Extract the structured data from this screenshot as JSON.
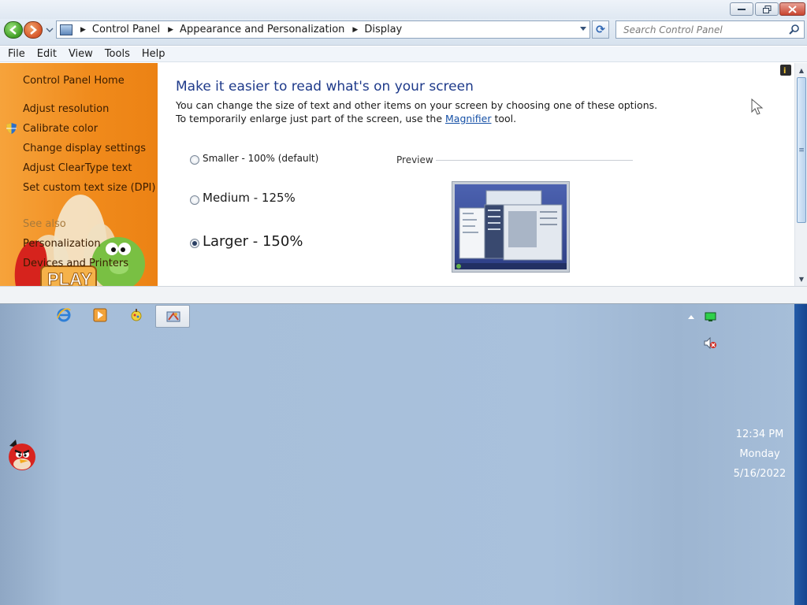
{
  "window": {
    "breadcrumbs": [
      "Control Panel",
      "Appearance and Personalization",
      "Display"
    ],
    "search_placeholder": "Search Control Panel",
    "menu": [
      "File",
      "Edit",
      "View",
      "Tools",
      "Help"
    ]
  },
  "sidebar": {
    "home": "Control Panel Home",
    "links": [
      "Adjust resolution",
      "Calibrate color",
      "Change display settings",
      "Adjust ClearType text",
      "Set custom text size (DPI)"
    ],
    "see_also_heading": "See also",
    "see_also": [
      "Personalization",
      "Devices and Printers"
    ]
  },
  "main": {
    "heading": "Make it easier to read what's on your screen",
    "desc_line1": "You can change the size of text and other items on your screen by choosing one of these options.",
    "desc_line2_prefix": "To temporarily enlarge just part of the screen, use the",
    "desc_link": "Magnifier",
    "desc_line2_suffix": "tool.",
    "options": [
      {
        "label": "Smaller - 100% (default)",
        "checked": false
      },
      {
        "label": "Medium - 125%",
        "checked": false
      },
      {
        "label": "Larger - 150%",
        "checked": true
      }
    ],
    "preview_label": "Preview"
  },
  "taskbar": {
    "pinned": [
      "internet-explorer-icon",
      "media-player-icon",
      "paint-icon",
      "control-panel-icon"
    ],
    "clock_time": "12:34 PM",
    "clock_day": "Monday",
    "clock_date": "5/16/2022"
  },
  "colors": {
    "sidebar_orange": "#f08a1b",
    "heading_blue": "#1e3a8a",
    "link_blue": "#1550a6",
    "taskbar_blue": "#a9c1dc"
  }
}
